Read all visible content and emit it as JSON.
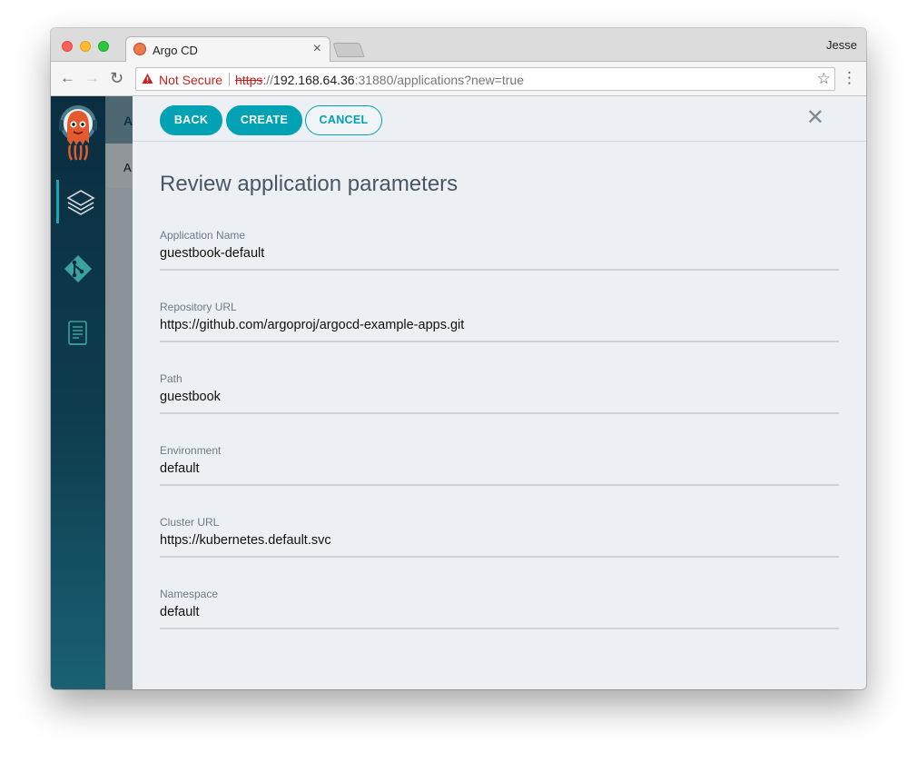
{
  "browser": {
    "profile_name": "Jesse",
    "tab": {
      "title": "Argo CD"
    },
    "address": {
      "security_label": "Not Secure",
      "scheme": "https",
      "scheme_sep": "://",
      "host": "192.168.64.36",
      "rest": ":31880/applications?new=true"
    }
  },
  "underlay": {
    "header_text": "A",
    "sub_text": "A"
  },
  "sidebar": {
    "items": [
      {
        "icon": "layers-icon",
        "active": true
      },
      {
        "icon": "git-icon",
        "active": false
      },
      {
        "icon": "book-icon",
        "active": false
      }
    ]
  },
  "panel": {
    "buttons": {
      "back": "BACK",
      "create": "CREATE",
      "cancel": "CANCEL"
    },
    "title": "Review application parameters",
    "fields": [
      {
        "label": "Application Name",
        "value": "guestbook-default"
      },
      {
        "label": "Repository URL",
        "value": "https://github.com/argoproj/argocd-example-apps.git"
      },
      {
        "label": "Path",
        "value": "guestbook"
      },
      {
        "label": "Environment",
        "value": "default"
      },
      {
        "label": "Cluster URL",
        "value": "https://kubernetes.default.svc"
      },
      {
        "label": "Namespace",
        "value": "default"
      }
    ]
  },
  "colors": {
    "accent": "#00a2b3",
    "sidebar_top": "#0b2d40",
    "sidebar_bottom": "#1a6174",
    "panel_bg": "#eceff3"
  }
}
